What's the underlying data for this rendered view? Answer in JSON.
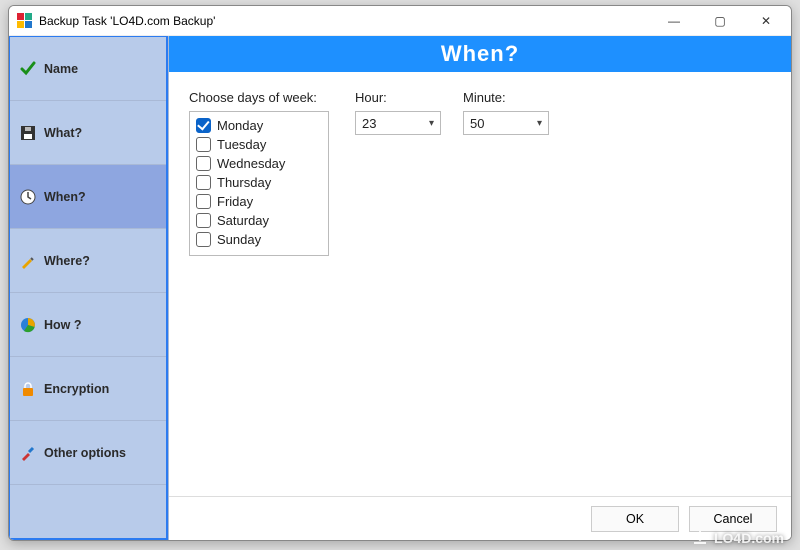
{
  "window": {
    "title": "Backup Task 'LO4D.com Backup'"
  },
  "titlebar": {
    "minimize": "—",
    "maximize": "▢",
    "close": "✕"
  },
  "sidebar": {
    "items": [
      {
        "key": "name",
        "label": "Name"
      },
      {
        "key": "what",
        "label": "What?"
      },
      {
        "key": "when",
        "label": "When?"
      },
      {
        "key": "where",
        "label": "Where?"
      },
      {
        "key": "how",
        "label": "How ?"
      },
      {
        "key": "encryption",
        "label": "Encryption"
      },
      {
        "key": "other",
        "label": "Other options"
      }
    ],
    "selected": "when"
  },
  "banner": {
    "title": "When?"
  },
  "pane": {
    "days_label": "Choose days of week:",
    "hour_label": "Hour:",
    "minute_label": "Minute:",
    "days": [
      {
        "name": "Monday",
        "checked": true
      },
      {
        "name": "Tuesday",
        "checked": false
      },
      {
        "name": "Wednesday",
        "checked": false
      },
      {
        "name": "Thursday",
        "checked": false
      },
      {
        "name": "Friday",
        "checked": false
      },
      {
        "name": "Saturday",
        "checked": false
      },
      {
        "name": "Sunday",
        "checked": false
      }
    ],
    "hour_value": "23",
    "minute_value": "50"
  },
  "footer": {
    "ok": "OK",
    "cancel": "Cancel"
  },
  "watermark": {
    "text": "LO4D.com"
  }
}
